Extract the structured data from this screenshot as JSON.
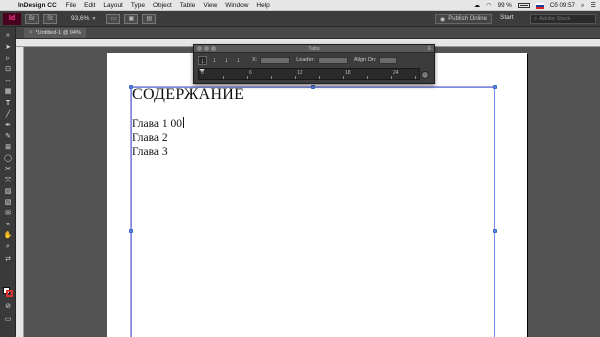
{
  "menubar": {
    "app_name": "InDesign CC",
    "items": [
      "File",
      "Edit",
      "Layout",
      "Type",
      "Object",
      "Table",
      "View",
      "Window",
      "Help"
    ],
    "battery": "99 %",
    "clock": "Сб 09:57"
  },
  "appbar": {
    "logo": "Id",
    "zoom": "93,6%",
    "publish_label": "Publish Online",
    "workspace": "Start",
    "search_placeholder": "Adobe Stock"
  },
  "document_tab": {
    "label": "*Untitled-1 @ 94%"
  },
  "tabs_panel": {
    "title": "Tabs",
    "x_label": "X:",
    "leader_label": "Leader:",
    "align_on_label": "Align On:",
    "ruler_numbers": [
      "0",
      "6",
      "12",
      "18",
      "24"
    ]
  },
  "document": {
    "heading": "СОДЕРЖАНИЕ",
    "lines": [
      "Глава 1 00",
      "Глава 2",
      "Глава 3"
    ]
  }
}
